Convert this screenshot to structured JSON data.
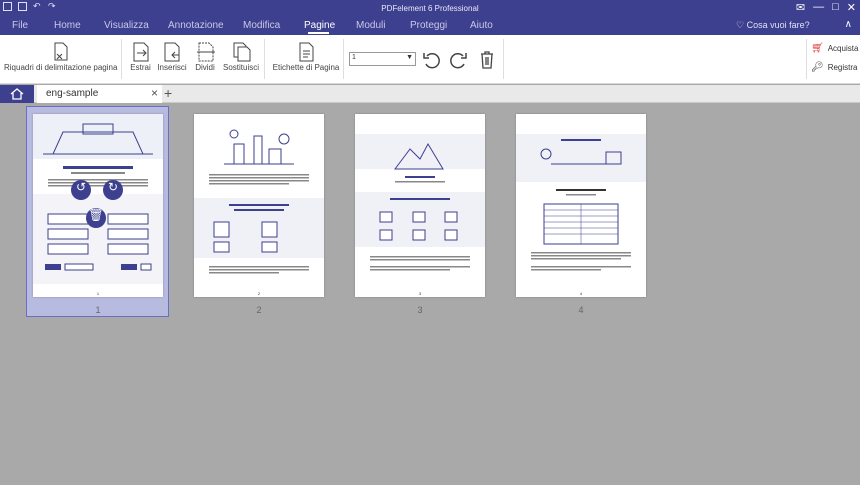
{
  "window": {
    "title": "PDFelement 6 Professional"
  },
  "menu": {
    "items": [
      "File",
      "Home",
      "Visualizza",
      "Annotazione",
      "Modifica",
      "Pagine",
      "Moduli",
      "Proteggi",
      "Aiuto"
    ],
    "active": "Pagine",
    "help_text": "Cosa vuoi fare?"
  },
  "ribbon": {
    "crop_label": "Riquadri di delimitazione pagina",
    "extract_label": "Estrai",
    "insert_label": "Inserisci",
    "split_label": "Dividi",
    "replace_label": "Sostituisci",
    "labels_label": "Etichette di Pagina",
    "page_select_value": "1",
    "buy_label": "Acquista",
    "register_label": "Registra"
  },
  "tabs": {
    "doc_name": "eng-sample"
  },
  "pages": {
    "numbers": [
      "1",
      "2",
      "3",
      "4"
    ],
    "mini_numbers": [
      "1",
      "2",
      "3",
      "4"
    ],
    "selected": "1"
  },
  "colors": {
    "accent": "#3d3f8f",
    "canvas": "#a9a9a9",
    "selection": "#b8bbe0"
  },
  "icons": [
    "crop-icon",
    "extract-icon",
    "insert-icon",
    "split-icon",
    "replace-icon",
    "page-labels-icon",
    "rotate-left-icon",
    "rotate-right-icon",
    "delete-icon",
    "cart-icon",
    "key-icon",
    "home-icon",
    "close-icon",
    "plus-icon",
    "help-bulb-icon"
  ]
}
